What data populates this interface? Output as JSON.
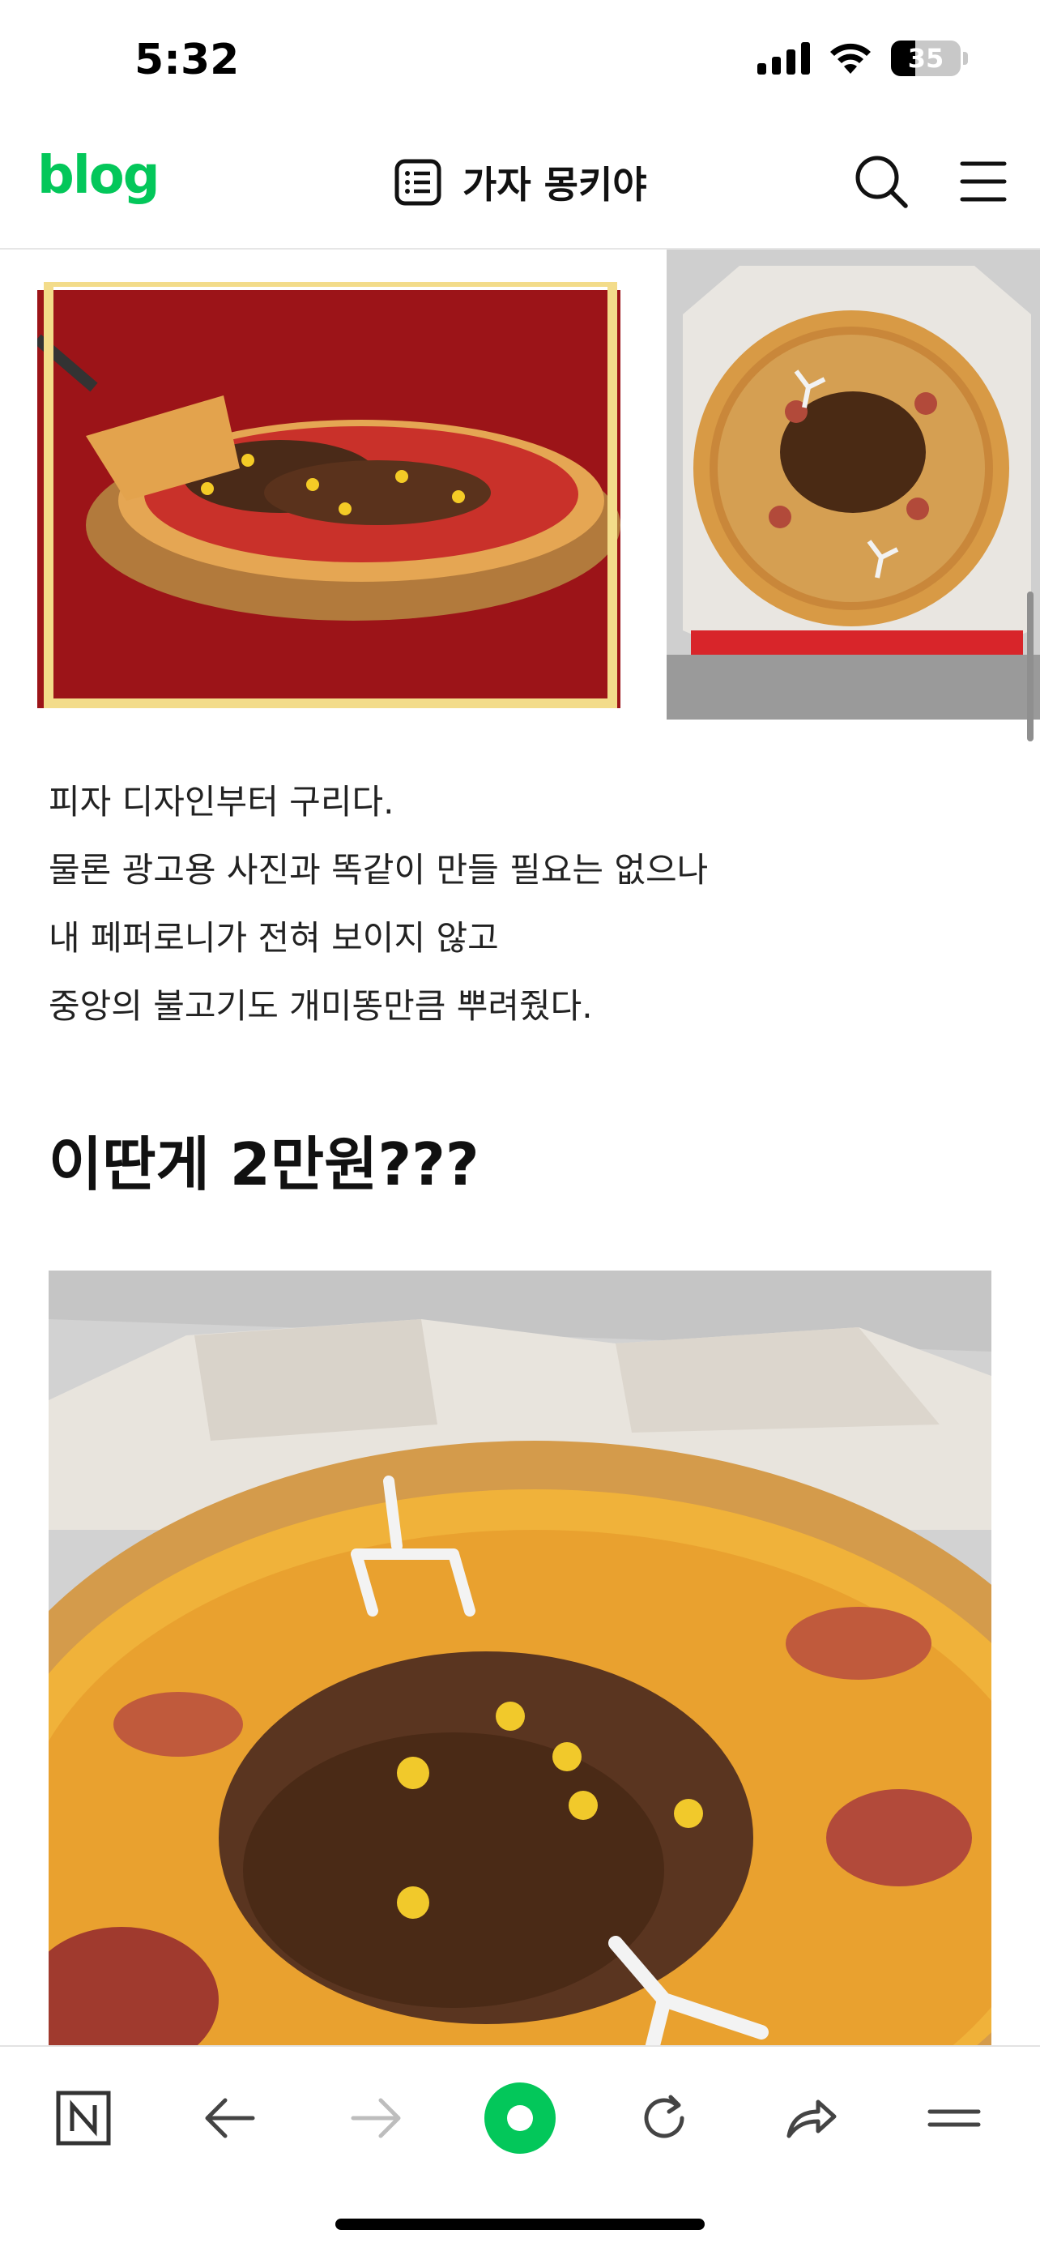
{
  "status_bar": {
    "time": "5:32",
    "battery_percent": "35",
    "battery_level": 0.35,
    "icons": [
      "signal-icon",
      "wifi-icon",
      "battery-icon"
    ]
  },
  "header": {
    "logo": "blog",
    "blog_title": "가자 몽키야",
    "icons": [
      "list-icon",
      "search-icon",
      "menu-icon"
    ],
    "brand_color": "#03c75a"
  },
  "post": {
    "paragraph": [
      "피자 디자인부터 구리다.",
      "물론 광고용 사진과 똑같이 만들 필요는 없으나",
      "내 페퍼로니가 전혀 보이지 않고",
      "중앙의 불고기도 개미똥만큼 뿌려줬다."
    ],
    "headline": "이딴게 2만원???",
    "images": [
      "ad-pizza-photo",
      "delivered-pizza-photo",
      "pizza-closeup-photo"
    ]
  },
  "toolbar": {
    "icons": [
      "naver-icon",
      "back-arrow-icon",
      "forward-arrow-icon",
      "green-dot-icon",
      "refresh-icon",
      "share-icon",
      "more-menu-icon"
    ],
    "accent_color": "#03c75a"
  }
}
